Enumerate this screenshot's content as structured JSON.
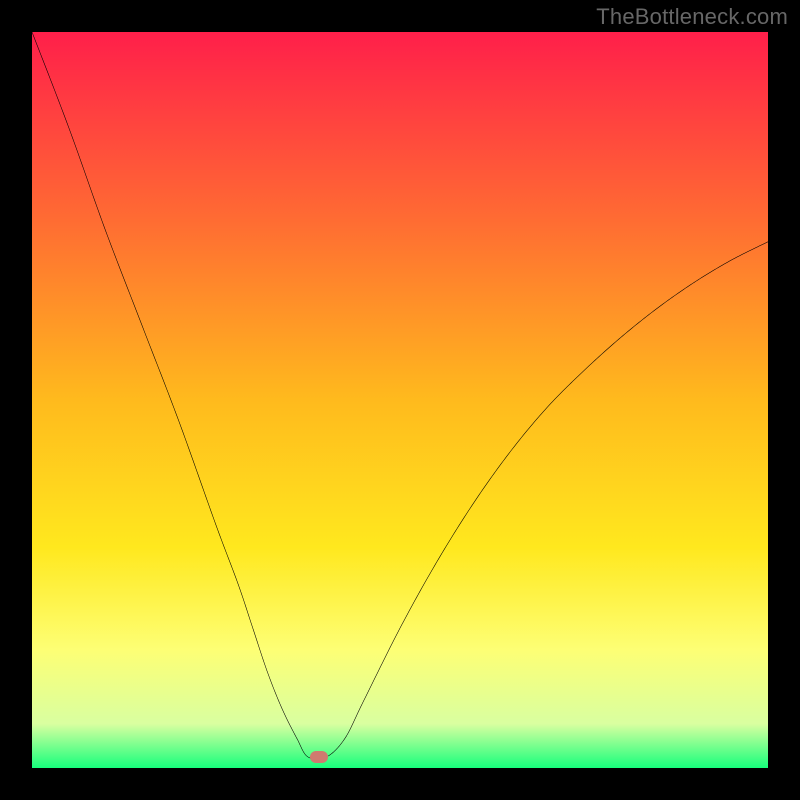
{
  "watermark": "TheBottleneck.com",
  "chart_data": {
    "type": "line",
    "title": "",
    "xlabel": "",
    "ylabel": "",
    "xlim": [
      0,
      100
    ],
    "ylim": [
      0,
      100
    ],
    "grid": false,
    "legend": false,
    "background": {
      "type": "vertical-gradient",
      "stops": [
        {
          "pos": 0.0,
          "color": "#ff1f4a"
        },
        {
          "pos": 0.25,
          "color": "#ff6a33"
        },
        {
          "pos": 0.5,
          "color": "#ffba1d"
        },
        {
          "pos": 0.7,
          "color": "#ffe81e"
        },
        {
          "pos": 0.84,
          "color": "#fdff75"
        },
        {
          "pos": 0.94,
          "color": "#d9ffa0"
        },
        {
          "pos": 1.0,
          "color": "#17ff7c"
        }
      ]
    },
    "series": [
      {
        "name": "bottleneck-curve",
        "color": "#000000",
        "x": [
          0,
          5,
          10,
          15,
          20,
          25,
          28,
          30,
          32,
          34,
          36,
          37.5,
          40,
          42.5,
          45,
          50,
          55,
          60,
          65,
          70,
          75,
          80,
          85,
          90,
          95,
          100
        ],
        "y": [
          100,
          87,
          73,
          60,
          47,
          33,
          25,
          19,
          13,
          8,
          4,
          1.5,
          1.5,
          4,
          9,
          19,
          28,
          36,
          43,
          49,
          54,
          58.5,
          62.5,
          66,
          69,
          71.5
        ]
      }
    ],
    "marker": {
      "name": "optimal-point",
      "x": 39,
      "y": 1.5,
      "color": "#cf7a6f"
    }
  }
}
